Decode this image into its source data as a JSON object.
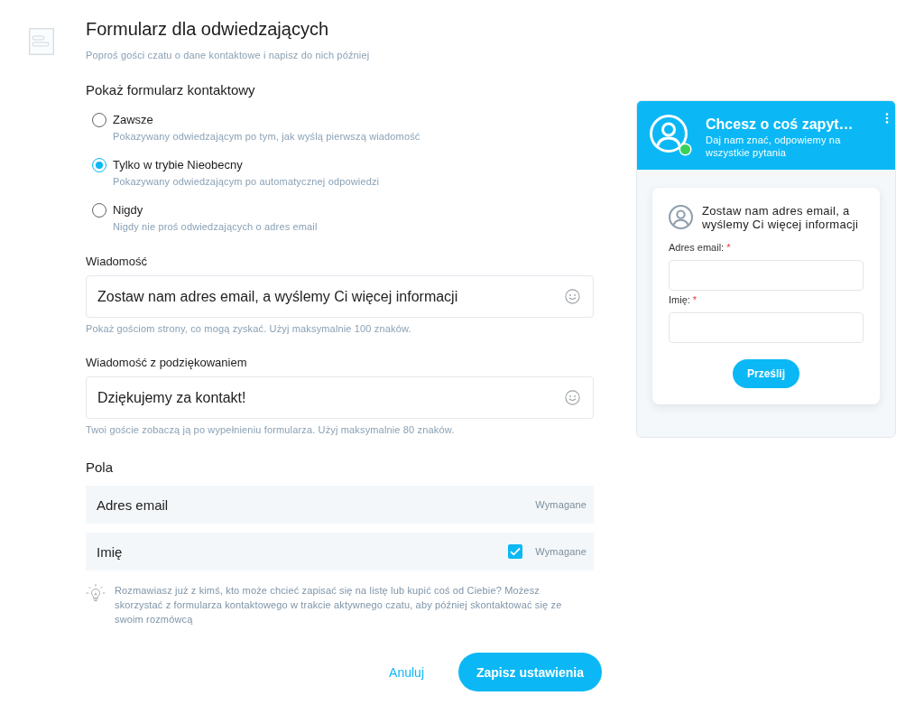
{
  "page": {
    "title": "Formularz dla odwiedzających",
    "subtitle": "Poproś gości czatu o dane kontaktowe i napisz do nich później"
  },
  "show_form": {
    "heading": "Pokaż formularz kontaktowy",
    "options": [
      {
        "label": "Zawsze",
        "description": "Pokazywany odwiedzającym po tym, jak wyślą pierwszą wiadomość",
        "selected": false
      },
      {
        "label": "Tylko w trybie Nieobecny",
        "description": "Pokazywany odwiedzającym po automatycznej odpowiedzi",
        "selected": true
      },
      {
        "label": "Nigdy",
        "description": "Nigdy nie proś odwiedzających o adres email",
        "selected": false
      }
    ]
  },
  "message": {
    "label": "Wiadomość",
    "value": "Zostaw nam adres email, a wyślemy Ci więcej informacji",
    "hint": "Pokaż gościom strony, co mogą zyskać. Użyj maksymalnie 100 znaków."
  },
  "thank_you_message": {
    "label": "Wiadomość z podziękowaniem",
    "value": "Dziękujemy za kontakt!",
    "hint": "Twoi goście zobaczą ją po wypełnieniu formularza. Użyj maksymalnie 80 znaków."
  },
  "fields": {
    "heading": "Pola",
    "rows": [
      {
        "kind": "fixed",
        "label": "Adres email",
        "required_label": "Wymagane"
      },
      {
        "kind": "toggle",
        "label": "Imię",
        "checked": true,
        "required_label": "Wymagane"
      }
    ]
  },
  "tip": "Rozmawiasz już z kimś, kto może chcieć zapisać się na listę lub kupić coś od Ciebie? Możesz skorzystać z formularza kontaktowego w trakcie aktywnego czatu, aby później skontaktować się ze swoim rozmówcą",
  "actions": {
    "cancel": "Anuluj",
    "save": "Zapisz ustawienia"
  },
  "preview": {
    "title": "Chcesz o coś zapyt…",
    "subtitle": "Daj nam znać, odpowiemy na wszystkie pytania",
    "online": true,
    "card": {
      "message": "Zostaw nam adres email, a wyślemy Ci więcej informacji",
      "inputs": [
        {
          "label": "Adres email:",
          "required_mark": "*"
        },
        {
          "label": "Imię:",
          "required_mark": "*"
        }
      ],
      "submit": "Prześlij"
    }
  }
}
